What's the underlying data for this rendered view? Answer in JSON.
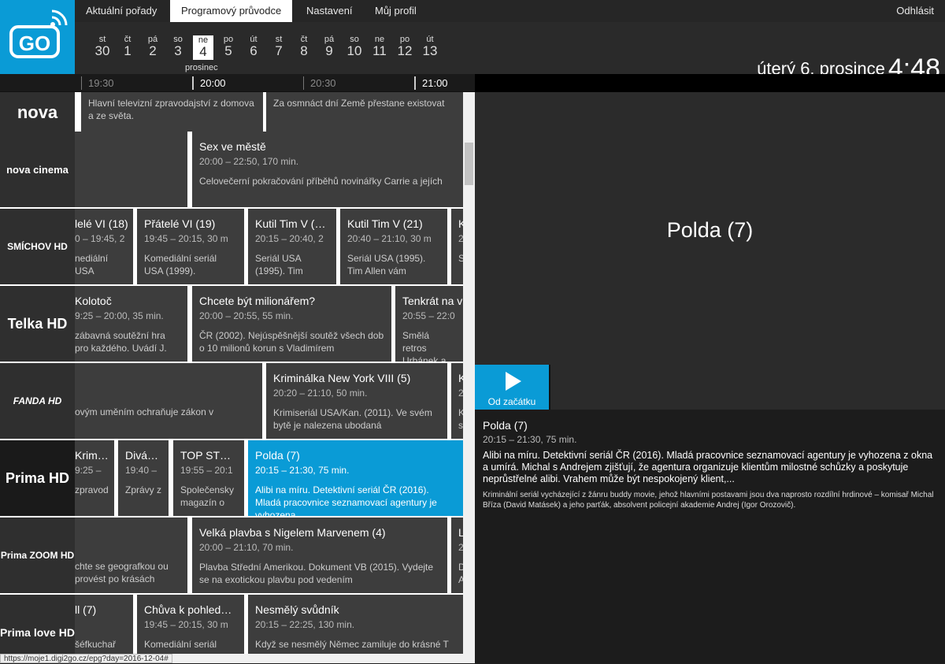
{
  "nav": {
    "tabs": [
      "Aktuální pořady",
      "Programový průvodce",
      "Nastavení",
      "Můj profil"
    ],
    "logout": "Odhlásit"
  },
  "logo_text": "GO",
  "dates": [
    {
      "n": "st",
      "d": "30"
    },
    {
      "n": "čt",
      "d": "1"
    },
    {
      "n": "pá",
      "d": "2"
    },
    {
      "n": "so",
      "d": "3"
    },
    {
      "n": "ne",
      "d": "4"
    },
    {
      "n": "po",
      "d": "5"
    },
    {
      "n": "út",
      "d": "6"
    },
    {
      "n": "st",
      "d": "7"
    },
    {
      "n": "čt",
      "d": "8"
    },
    {
      "n": "pá",
      "d": "9"
    },
    {
      "n": "so",
      "d": "10"
    },
    {
      "n": "ne",
      "d": "11"
    },
    {
      "n": "po",
      "d": "12"
    },
    {
      "n": "út",
      "d": "13"
    }
  ],
  "month": "prosinec",
  "clock": {
    "date": "úterý 6. prosince",
    "time": "4:48"
  },
  "timeline": [
    "19:30",
    "20:00",
    "20:30",
    "21:00"
  ],
  "channels": [
    "nova",
    "nova cinema",
    "SMÍCHOV HD",
    "Telka HD",
    "FANDA HD",
    "Prima HD",
    "Prima ZOOM HD",
    "Prima love HD"
  ],
  "programs": {
    "r0": [
      {
        "t": "",
        "tt": "",
        "d": "Hlavní televizní zpravodajství z domova a ze světa."
      },
      {
        "t": "",
        "tt": "",
        "d": "Za osmnáct dní Země přestane existovat"
      }
    ],
    "r1": [
      {
        "t": "",
        "tt": "",
        "d": ""
      },
      {
        "t": "Sex ve městě",
        "tt": "20:00 – 22:50, 170 min.",
        "d": "Celovečerní pokračování příběhů novinářky Carrie a jejích"
      }
    ],
    "r2": [
      {
        "t": "lelé VI (18)",
        "tt": "0 – 19:45, 2",
        "d": "nediální USA"
      },
      {
        "t": "Přátelé VI (19)",
        "tt": "19:45 – 20:15, 30 m",
        "d": "Komediální seriál USA (1999)."
      },
      {
        "t": "Kutil Tim V (…",
        "tt": "20:15 – 20:40, 2",
        "d": "Seriál USA (1995). Tim"
      },
      {
        "t": "Kutil Tim V (21)",
        "tt": "20:40 – 21:10, 30 m",
        "d": "Seriál USA (1995). Tim Allen vám"
      },
      {
        "t": "K",
        "tt": "2",
        "d": "S"
      }
    ],
    "r3": [
      {
        "t": "Kolotoč",
        "tt": "9:25 – 20:00, 35 min.",
        "d": "zábavná soutěžní hra pro každého. Uvádí J."
      },
      {
        "t": "Chcete být milionářem?",
        "tt": "20:00 – 20:55, 55 min.",
        "d": "ČR (2002). Nejúspěšnější soutěž všech dob o 10 milionů korun s Vladimírem"
      },
      {
        "t": "Tenkrát na v",
        "tt": "20:55 – 22:0",
        "d": "Smělá retros Urbánek a hv"
      }
    ],
    "r4": [
      {
        "t": "",
        "tt": "",
        "d": "ovým uměním ochraňuje zákon v"
      },
      {
        "t": "Kriminálka New York VIII (5)",
        "tt": "20:20 – 21:10, 50 min.",
        "d": "Krimiseriál USA/Kan. (2011). Ve svém bytě je nalezena ubodaná"
      },
      {
        "t": "K",
        "tt": "2",
        "d": "K s"
      }
    ],
    "r5": [
      {
        "t": "Krim…",
        "tt": "9:25 –",
        "d": "zpravod"
      },
      {
        "t": "Divá…",
        "tt": "19:40 –",
        "d": "Zprávy z"
      },
      {
        "t": "TOP ST…",
        "tt": "19:55 – 20:1",
        "d": "Společensky magazín o"
      },
      {
        "t": "Polda (7)",
        "tt": "20:15 – 21:30, 75 min.",
        "d": "Alibi na míru. Detektivní seriál ČR (2016). Mladá pracovnice seznamovací agentury je vyhozena"
      }
    ],
    "r6": [
      {
        "t": "",
        "tt": "",
        "d": "chte se geografkou ou provést po krásách"
      },
      {
        "t": "Velká plavba s Nigelem Marvenem (4)",
        "tt": "20:00 – 21:10, 70 min.",
        "d": "Plavba Střední Amerikou. Dokument VB (2015). Vydejte se na exotickou plavbu pod vedením"
      },
      {
        "t": "L",
        "tt": "2",
        "d": "D A"
      }
    ],
    "r7": [
      {
        "t": "ll (7)",
        "tt": "",
        "d": "šéfkuchař"
      },
      {
        "t": "Chůva k pohled…",
        "tt": "19:45 – 20:15, 30 m",
        "d": "Komediální seriál"
      },
      {
        "t": "Nesmělý svůdník",
        "tt": "20:15 – 22:25, 130 min.",
        "d": "Když se nesmělý Němec zamiluje do krásné T"
      }
    ]
  },
  "preview_title": "Polda (7)",
  "play_label": "Od začátku",
  "detail": {
    "title": "Polda (7)",
    "time": "20:15 – 21:30, 75 min.",
    "desc": "Alibi na míru. Detektivní seriál ČR (2016). Mladá pracovnice seznamovací agentury je vyhozena z okna a umírá. Michal s Andrejem zjišťují, že agentura organizuje klientům milostné schůzky a poskytuje neprůstřelné alibi. Vrahem může být nespokojený klient,...",
    "extra": "Kriminální seriál vycházející z žánru buddy movie, jehož hlavními postavami jsou dva naprosto rozdílní hrdinové – komisař Michal Bříza (David Matásek) a jeho parťák, absolvent policejní akademie Andrej (Igor Orozovič)."
  },
  "status_url": "https://moje1.digi2go.cz/epg?day=2016-12-04#",
  "colors": {
    "accent": "#0a9bd6",
    "tile": "#3d3d3d",
    "channel": "#2f2f2f"
  }
}
